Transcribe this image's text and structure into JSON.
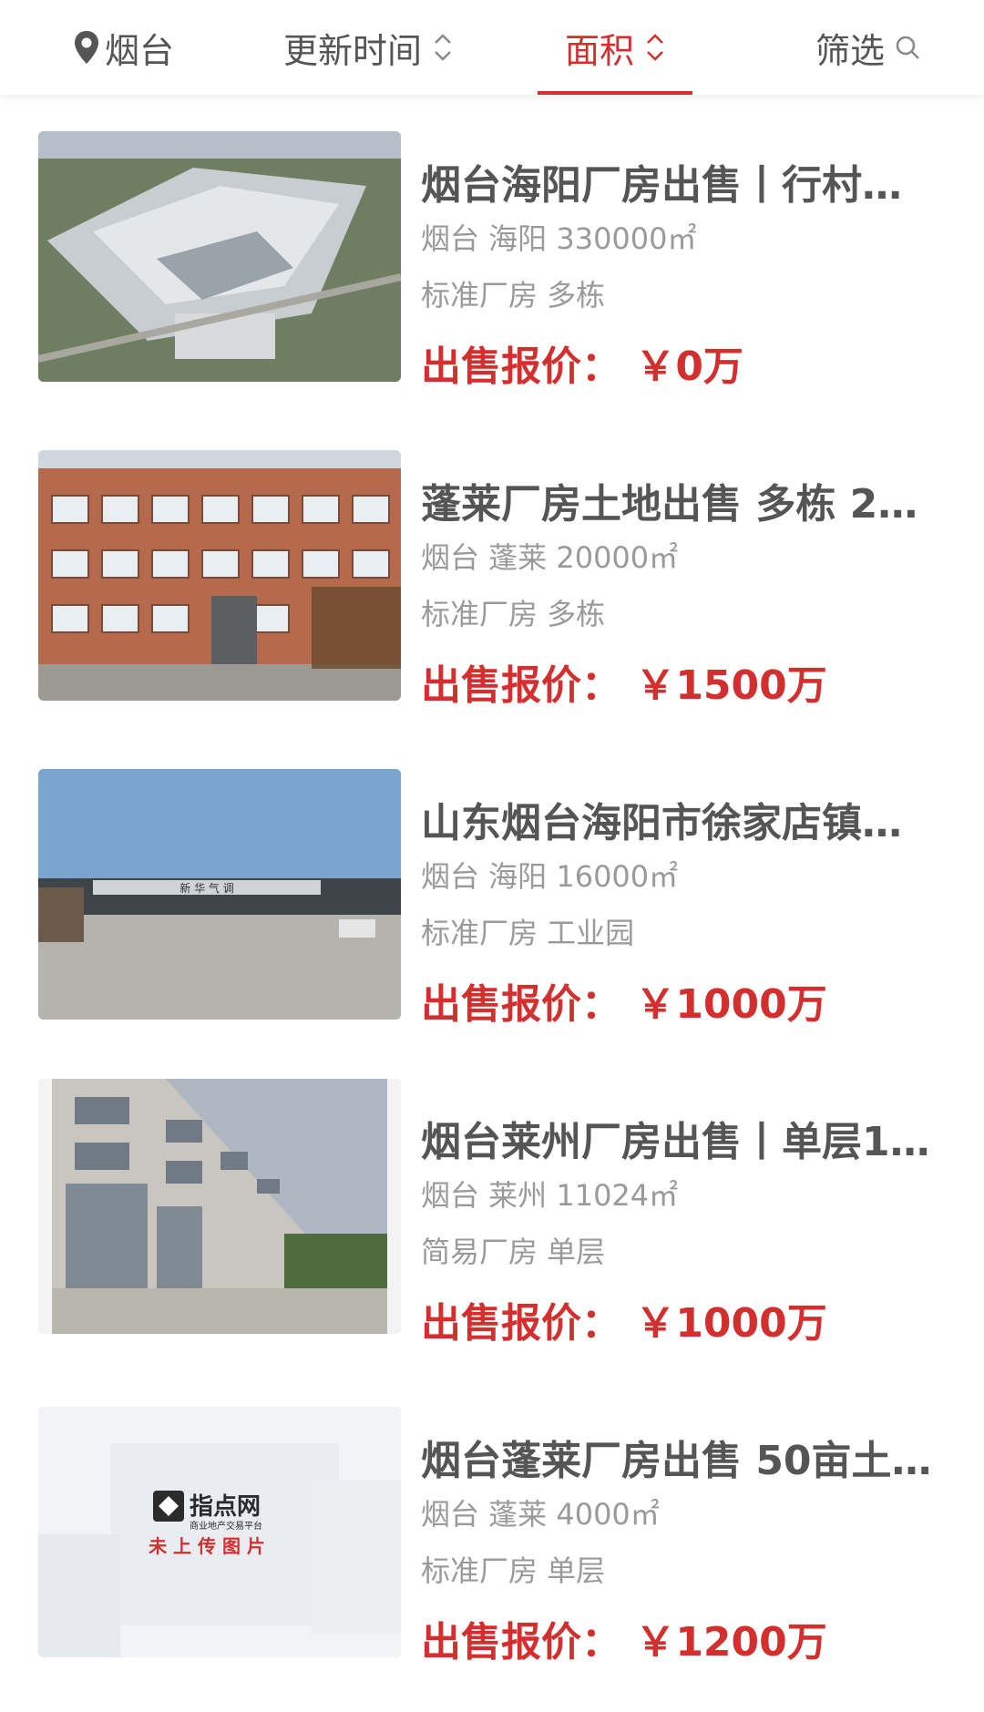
{
  "nav": {
    "location": "烟台",
    "sort_update_time": "更新时间",
    "sort_area": "面积",
    "filter": "筛选"
  },
  "listings": [
    {
      "title": "烟台海阳厂房出售丨行村…",
      "meta": "烟台 海阳 330000㎡",
      "tags": "标准厂房 多栋",
      "price": "出售报价： ￥0万"
    },
    {
      "title": "蓬莱厂房土地出售 多栋 2…",
      "meta": "烟台 蓬莱 20000㎡",
      "tags": "标准厂房 多栋",
      "price": "出售报价： ￥1500万"
    },
    {
      "title": "山东烟台海阳市徐家店镇…",
      "meta": "烟台 海阳 16000㎡",
      "tags": "标准厂房 工业园",
      "price": "出售报价： ￥1000万",
      "sign": "新 华 气 调"
    },
    {
      "title": "烟台莱州厂房出售丨单层1…",
      "meta": "烟台 莱州 11024㎡",
      "tags": "简易厂房 单层",
      "price": "出售报价： ￥1000万"
    },
    {
      "title": "烟台蓬莱厂房出售 50亩土…",
      "meta": "烟台 蓬莱 4000㎡",
      "tags": "标准厂房 单层",
      "price": "出售报价： ￥1200万",
      "placeholder_logo": "指点网",
      "placeholder_sub": "商业地产交易平台",
      "placeholder_text": "未 上 传 图 片"
    }
  ],
  "colors": {
    "accent": "#d32f2f",
    "title": "#555555",
    "meta": "#9a9a9a"
  }
}
